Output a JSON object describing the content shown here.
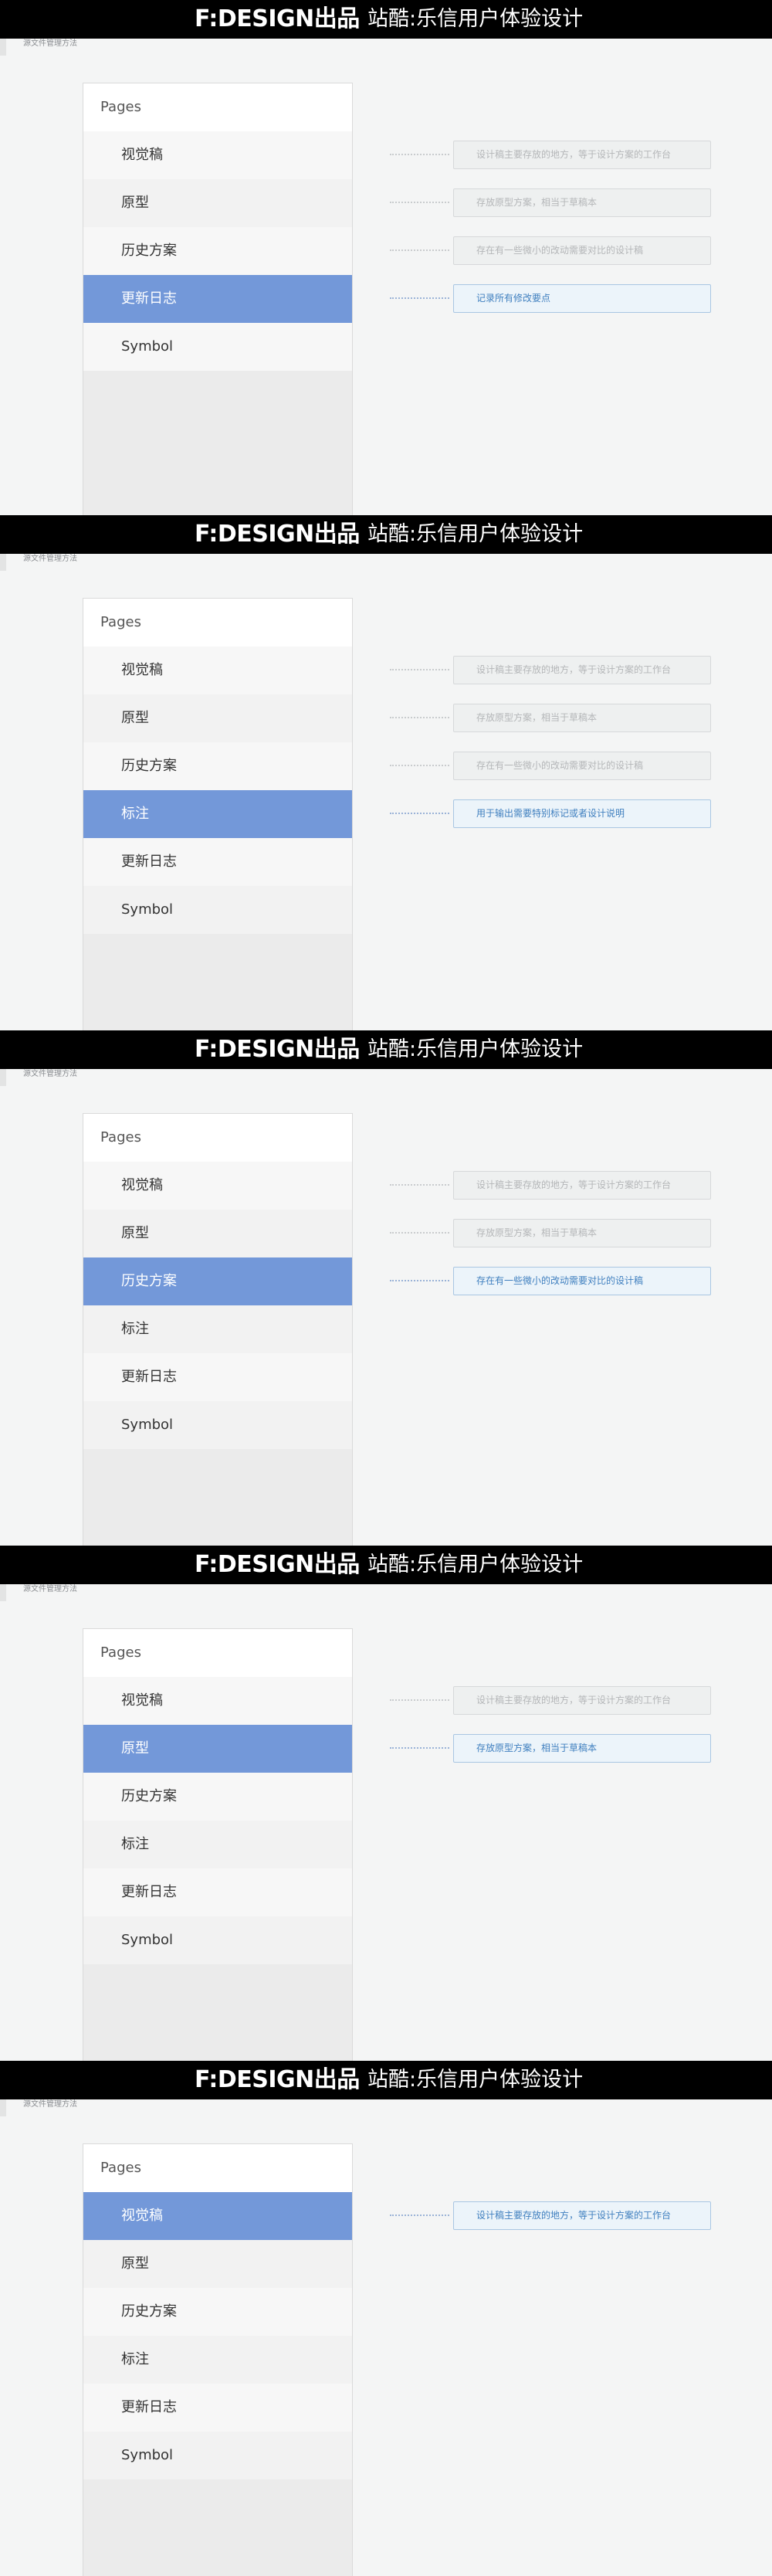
{
  "banner": {
    "logo": "F:DESIGN出品",
    "title": "站酷:乐信用户体验设计"
  },
  "colors": {
    "banner_bg": "#000000",
    "page_bg": "#f4f5f5",
    "active_item": "#7398d9",
    "active_note_text": "#3f7fbf"
  },
  "panels": [
    {
      "caption": "源文件管理方法",
      "sidebar_title": "Pages",
      "items": [
        {
          "label": "视觉稿",
          "active": false
        },
        {
          "label": "原型",
          "active": false
        },
        {
          "label": "历史方案",
          "active": false
        },
        {
          "label": "更新日志",
          "active": true
        },
        {
          "label": "Symbol",
          "active": false
        }
      ],
      "notes": [
        {
          "text": "设计稿主要存放的地方，等于设计方案的工作台",
          "active": false
        },
        {
          "text": "存放原型方案，相当于草稿本",
          "active": false
        },
        {
          "text": "存在有一些微小的改动需要对比的设计稿",
          "active": false
        },
        {
          "text": "记录所有修改要点",
          "active": true
        }
      ]
    },
    {
      "caption": "源文件管理方法",
      "sidebar_title": "Pages",
      "items": [
        {
          "label": "视觉稿",
          "active": false
        },
        {
          "label": "原型",
          "active": false
        },
        {
          "label": "历史方案",
          "active": false
        },
        {
          "label": "标注",
          "active": true
        },
        {
          "label": "更新日志",
          "active": false
        },
        {
          "label": "Symbol",
          "active": false
        }
      ],
      "notes": [
        {
          "text": "设计稿主要存放的地方，等于设计方案的工作台",
          "active": false
        },
        {
          "text": "存放原型方案，相当于草稿本",
          "active": false
        },
        {
          "text": "存在有一些微小的改动需要对比的设计稿",
          "active": false
        },
        {
          "text": "用于输出需要特别标记或者设计说明",
          "active": true
        }
      ]
    },
    {
      "caption": "源文件管理方法",
      "sidebar_title": "Pages",
      "items": [
        {
          "label": "视觉稿",
          "active": false
        },
        {
          "label": "原型",
          "active": false
        },
        {
          "label": "历史方案",
          "active": true
        },
        {
          "label": "标注",
          "active": false
        },
        {
          "label": "更新日志",
          "active": false
        },
        {
          "label": "Symbol",
          "active": false
        }
      ],
      "notes": [
        {
          "text": "设计稿主要存放的地方，等于设计方案的工作台",
          "active": false
        },
        {
          "text": "存放原型方案，相当于草稿本",
          "active": false
        },
        {
          "text": "存在有一些微小的改动需要对比的设计稿",
          "active": true
        }
      ]
    },
    {
      "caption": "源文件管理方法",
      "sidebar_title": "Pages",
      "items": [
        {
          "label": "视觉稿",
          "active": false
        },
        {
          "label": "原型",
          "active": true
        },
        {
          "label": "历史方案",
          "active": false
        },
        {
          "label": "标注",
          "active": false
        },
        {
          "label": "更新日志",
          "active": false
        },
        {
          "label": "Symbol",
          "active": false
        }
      ],
      "notes": [
        {
          "text": "设计稿主要存放的地方，等于设计方案的工作台",
          "active": false
        },
        {
          "text": "存放原型方案，相当于草稿本",
          "active": true
        }
      ]
    },
    {
      "caption": "源文件管理方法",
      "sidebar_title": "Pages",
      "items": [
        {
          "label": "视觉稿",
          "active": true
        },
        {
          "label": "原型",
          "active": false
        },
        {
          "label": "历史方案",
          "active": false
        },
        {
          "label": "标注",
          "active": false
        },
        {
          "label": "更新日志",
          "active": false
        },
        {
          "label": "Symbol",
          "active": false
        }
      ],
      "notes": [
        {
          "text": "设计稿主要存放的地方，等于设计方案的工作台",
          "active": true
        }
      ]
    }
  ]
}
